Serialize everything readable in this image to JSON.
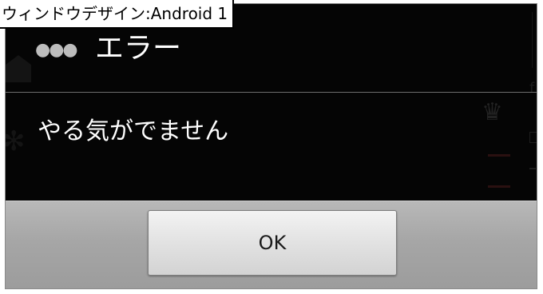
{
  "caption": "ウィンドウデザイン:Android 1",
  "dialog": {
    "title": "エラー",
    "message": "やる気がでません",
    "ok_label": "OK"
  },
  "icons": {
    "overflow": "overflow-menu-icon"
  },
  "colors": {
    "dialog_background": "#050505",
    "button_bar": "#a6a6a6",
    "button_face": "#e2e2e2",
    "title_text": "#ffffff"
  }
}
